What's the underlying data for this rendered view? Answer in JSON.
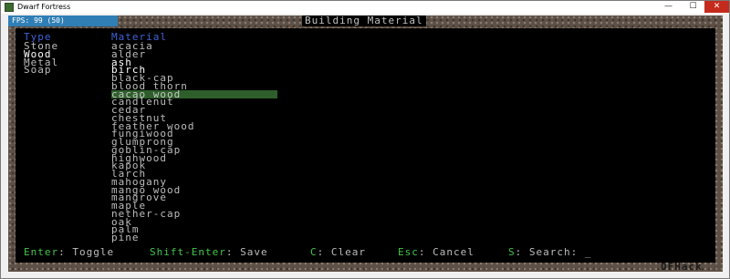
{
  "window": {
    "title": "Dwarf Fortress",
    "minimize_glyph": "—",
    "maximize_glyph": "☐",
    "close_glyph": "✕"
  },
  "fps": {
    "label": "FPS:  99 (50)"
  },
  "screen": {
    "title": "Building Material"
  },
  "type_column": {
    "header": "Type",
    "items": [
      "Stone",
      "Wood",
      "Metal",
      "Soap"
    ],
    "selected": "Wood"
  },
  "material_column": {
    "header": "Material",
    "items": [
      "acacia",
      "alder",
      "ash",
      "birch",
      "black-cap",
      "blood thorn",
      "cacao wood",
      "candlenut",
      "cedar",
      "chestnut",
      "feather wood",
      "fungiwood",
      "glumprong",
      "goblin-cap",
      "highwood",
      "kapok",
      "larch",
      "mahogany",
      "mango wood",
      "mangrove",
      "maple",
      "nether-cap",
      "oak",
      "palm",
      "pine"
    ],
    "bright": [
      "ash",
      "birch"
    ],
    "highlighted": "cacao wood"
  },
  "footer": {
    "items": [
      {
        "key": "Enter",
        "desc": ": Toggle"
      },
      {
        "key": "Shift-Enter",
        "desc": ": Save"
      },
      {
        "key": "C",
        "desc": ": Clear"
      },
      {
        "key": "Esc",
        "desc": ": Cancel"
      },
      {
        "key": "S",
        "desc": ": Search: _"
      }
    ]
  },
  "brand": "DFHack",
  "colors": {
    "key_green": "#43c64a",
    "header_blue": "#3d63d8",
    "highlight_bg": "#2e5f2b",
    "fps_bar": "#2f7fb5",
    "close_button": "#c42b1c"
  }
}
